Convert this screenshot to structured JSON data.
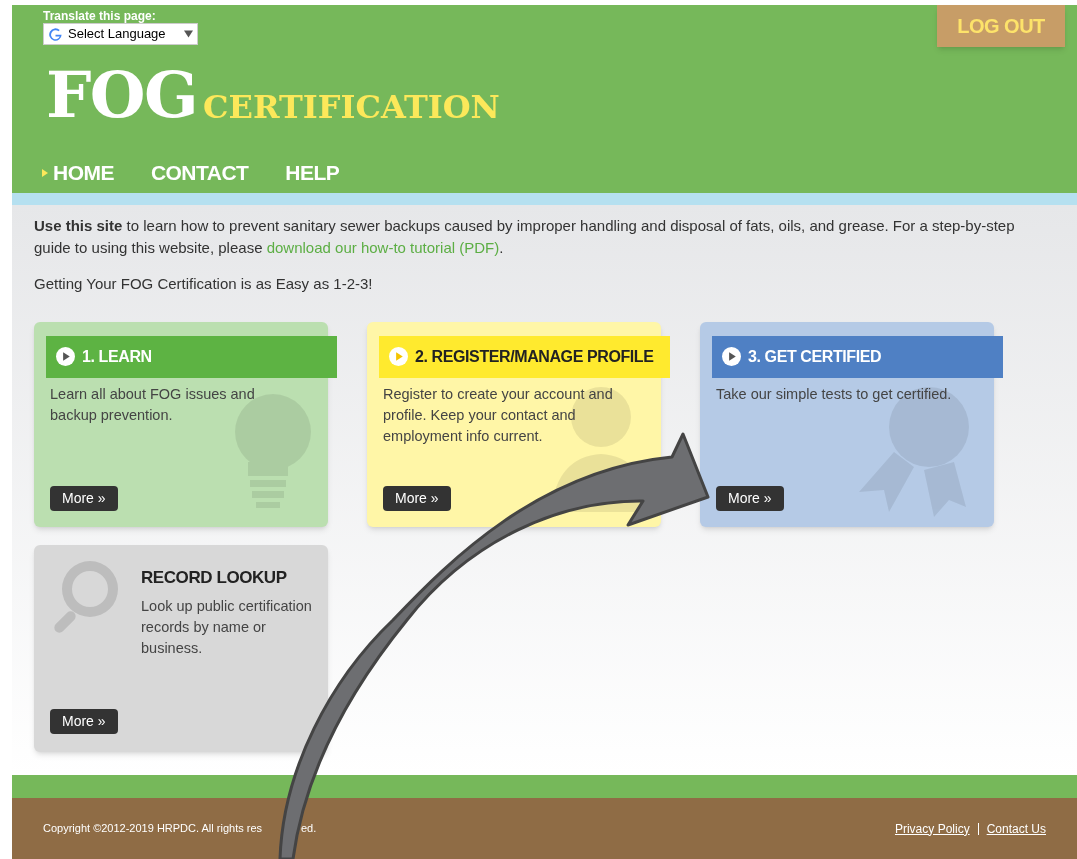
{
  "header": {
    "translate_label": "Translate this page:",
    "language_select": "Select Language",
    "logo": {
      "main": "FOG",
      "sub": "CERTIFICATION"
    },
    "logout": "LOG OUT",
    "nav": [
      {
        "label": "HOME",
        "selected": true
      },
      {
        "label": "CONTACT",
        "selected": false
      },
      {
        "label": "HELP",
        "selected": false
      }
    ]
  },
  "intro": {
    "text": "**Use this site** to learn how to prevent sanitary sewer backups caused by improper handling and disposal of fats, oils, and grease. For a step-by-step guide to using this website, please ",
    "link": "download our how-to tutorial (PDF)",
    "end": "."
  },
  "subtitle": "Getting Your FOG Certification is as Easy as 1-2-3!",
  "cards": [
    {
      "kind": "step",
      "title": "1. LEARN",
      "color": "#5db343",
      "text": "Learn all about FOG issues and backup prevention.",
      "button": "More »"
    },
    {
      "kind": "step",
      "title": "2. REGISTER/MANAGE PROFILE",
      "color": "#ffea2e",
      "text": "Register to create your account and profile. Keep your contact and employment info current.",
      "button": "More »"
    },
    {
      "kind": "step",
      "title": "3. GET CERTIFIED",
      "color": "#4f80c4",
      "text": "Take our simple tests to get certified.",
      "button": "More »"
    },
    {
      "kind": "lookup",
      "title": "RECORD LOOKUP",
      "color": "#d8d8d8",
      "text": "Look up public certification records by name or business.",
      "button": "More »"
    }
  ],
  "footer": {
    "copyright_parts": [
      "Copyright ©2012-2019 HRPDC. All rights res",
      "ed."
    ],
    "links": [
      "Privacy Policy",
      "Contact Us"
    ]
  }
}
